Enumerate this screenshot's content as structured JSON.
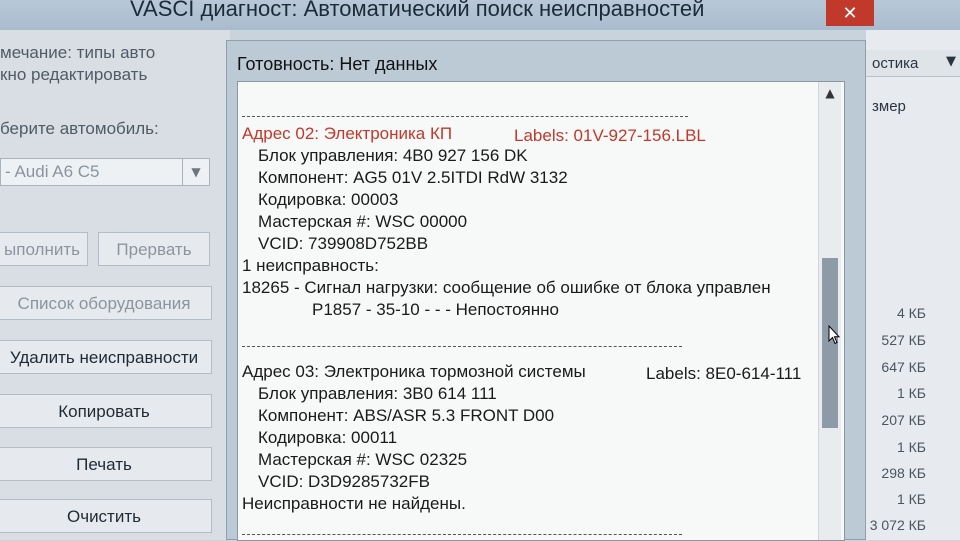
{
  "window": {
    "title": "VASCI диагност: Автоматический поиск неисправностей",
    "close_label": "✕"
  },
  "left_panel": {
    "note_line1": "мечание: типы авто",
    "note_line2": "кно редактировать",
    "select_label": "берите автомобиль:",
    "car_select_value": "- Audi A6 C5",
    "buttons": {
      "execute": "ыполнить",
      "abort": "Прервать",
      "equipment_list": "Список оборудования",
      "delete_faults": "Удалить неисправности",
      "copy": "Копировать",
      "print": "Печать",
      "clear": "Очистить"
    }
  },
  "dialog": {
    "ready": "Готовность: Нет данных",
    "address02": {
      "header": "Адрес 02:   Электроника КП",
      "labels": "Labels: 01V-927-156.LBL",
      "control_unit": "Блок управления: 4B0 927 156 DK",
      "component": "Компонент: AG5 01V 2.5ITDI RdW 3132",
      "coding": "Кодировка: 00003",
      "workshop": "Мастерская #: WSC 00000",
      "vcid": "VCID: 739908D752BB",
      "faults_count": "1 неисправность:",
      "fault_line": "18265 -   Сигнал нагрузки: сообщение об ошибке от блока управлен",
      "fault_detail": "P1857 - 35-10 -    - - Непостоянно"
    },
    "address03": {
      "header": "Адрес 03:   Электроника тормозной системы",
      "labels": "Labels: 8E0-614-111",
      "control_unit": "Блок управления: 3B0 614 111",
      "component": "Компонент: ABS/ASR 5.3 FRONT   D00",
      "coding": "Кодировка: 00011",
      "workshop": "Мастерская #: WSC 02325",
      "vcid": "VCID: D3D9285732FB",
      "no_faults": "Неисправности не найдены."
    }
  },
  "right_panel": {
    "column_header": "остика",
    "column2": "змер",
    "sizes": [
      "4 КБ",
      "527 КБ",
      "647 КБ",
      "1 КБ",
      "207 КБ",
      "1 КБ",
      "298 КБ",
      "1 КБ",
      "3 072 КБ"
    ]
  },
  "colors": {
    "accent_red": "#c0392b",
    "scroll_thumb": "#8d9aa8"
  }
}
